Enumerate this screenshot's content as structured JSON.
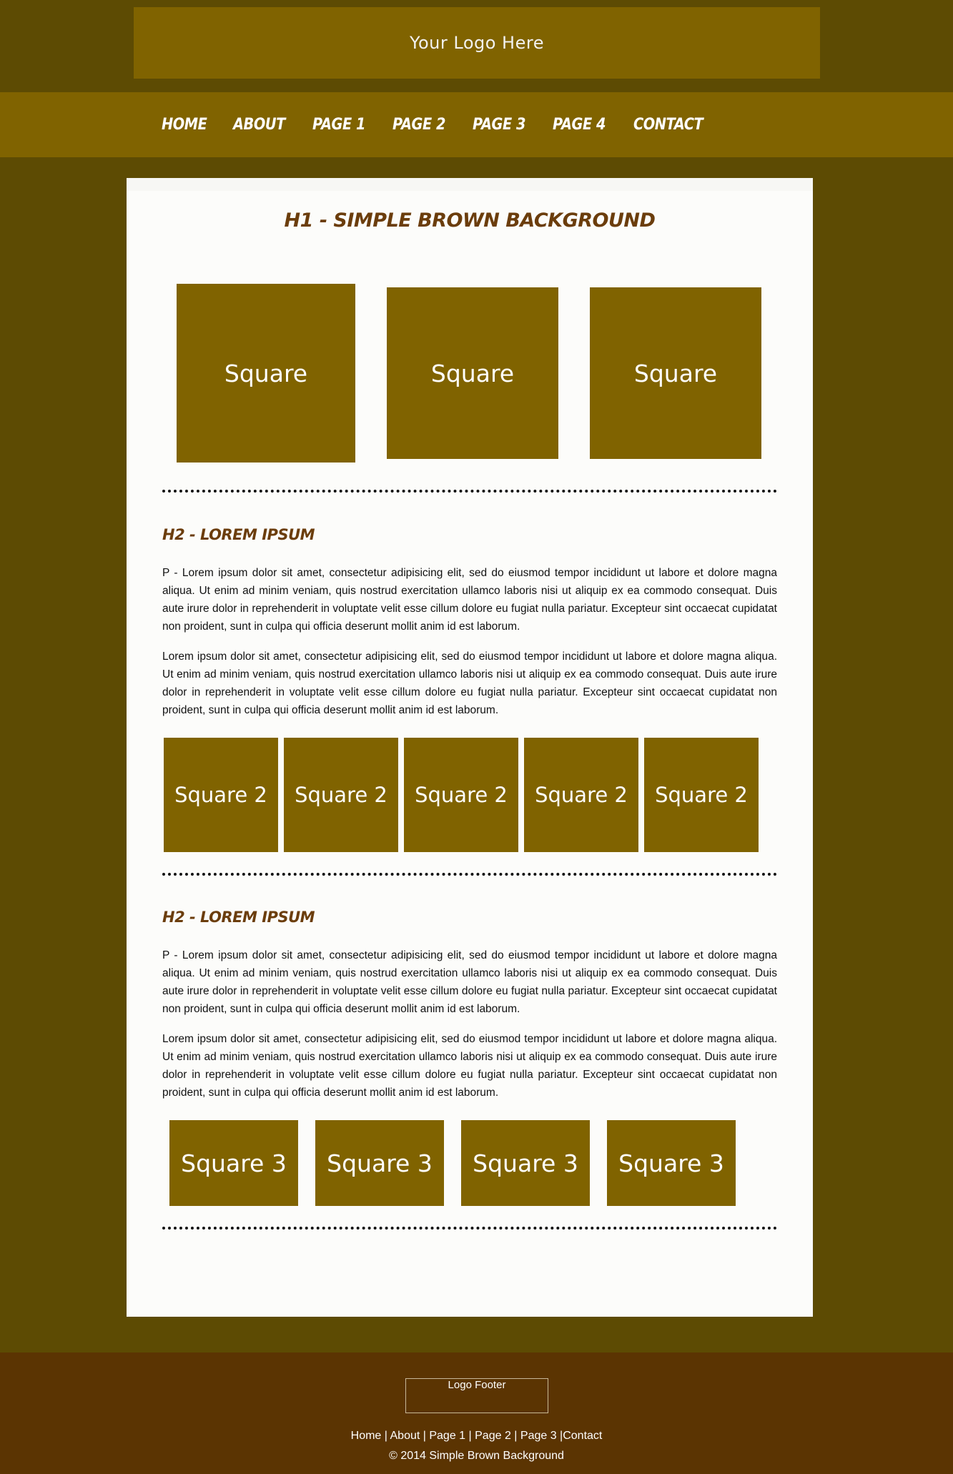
{
  "header": {
    "logo_text": "Your Logo Here"
  },
  "nav": {
    "items": [
      {
        "label": "Home"
      },
      {
        "label": "About"
      },
      {
        "label": "Page 1"
      },
      {
        "label": "Page 2"
      },
      {
        "label": "Page 3"
      },
      {
        "label": "Page 4"
      },
      {
        "label": "Contact"
      }
    ]
  },
  "main": {
    "h1": "H1 - Simple Brown Background",
    "squares_row1": [
      "Square",
      "Square",
      "Square"
    ],
    "section1": {
      "h2": "H2 - Lorem Ipsum",
      "p1": "P - Lorem ipsum dolor sit amet, consectetur adipisicing elit, sed do eiusmod tempor incididunt ut labore et dolore magna aliqua. Ut enim ad minim veniam, quis nostrud exercitation ullamco laboris nisi ut aliquip ex ea commodo consequat. Duis aute irure dolor in reprehenderit in voluptate velit esse cillum dolore eu fugiat nulla pariatur. Excepteur sint occaecat cupidatat non proident, sunt in culpa qui officia deserunt mollit anim id est laborum.",
      "p2": "Lorem ipsum dolor sit amet, consectetur adipisicing elit, sed do eiusmod tempor incididunt ut labore et dolore magna aliqua. Ut enim ad minim veniam, quis nostrud exercitation ullamco laboris nisi ut aliquip ex ea commodo consequat. Duis aute irure dolor in reprehenderit in voluptate velit esse cillum dolore eu fugiat nulla pariatur. Excepteur sint occaecat cupidatat non proident, sunt in culpa qui officia deserunt mollit anim id est laborum.",
      "squares": [
        "Square 2",
        "Square 2",
        "Square 2",
        "Square 2",
        "Square 2"
      ]
    },
    "section2": {
      "h2": "H2 - Lorem Ipsum",
      "p1": "P - Lorem ipsum dolor sit amet, consectetur adipisicing elit, sed do eiusmod tempor incididunt ut labore et dolore magna aliqua. Ut enim ad minim veniam, quis nostrud exercitation ullamco laboris nisi ut aliquip ex ea commodo consequat. Duis aute irure dolor in reprehenderit in voluptate velit esse cillum dolore eu fugiat nulla pariatur. Excepteur sint occaecat cupidatat non proident, sunt in culpa qui officia deserunt mollit anim id est laborum.",
      "p2": "Lorem ipsum dolor sit amet, consectetur adipisicing elit, sed do eiusmod tempor incididunt ut labore et dolore magna aliqua. Ut enim ad minim veniam, quis nostrud exercitation ullamco laboris nisi ut aliquip ex ea commodo consequat. Duis aute irure dolor in reprehenderit in voluptate velit esse cillum dolore eu fugiat nulla pariatur. Excepteur sint occaecat cupidatat non proident, sunt in culpa qui officia deserunt mollit anim id est laborum.",
      "squares": [
        "Square 3",
        "Square 3",
        "Square 3",
        "Square 3"
      ]
    }
  },
  "footer": {
    "logo_text": "Logo Footer",
    "links": [
      {
        "label": "Home"
      },
      {
        "label": "About"
      },
      {
        "label": "Page 1"
      },
      {
        "label": "Page 2"
      },
      {
        "label": "Page 3"
      },
      {
        "label": "Contact"
      }
    ],
    "sep": " | ",
    "sep_last": " |",
    "copyright": "© 2014 Simple Brown Background"
  },
  "colors": {
    "page_bg": "#5d4b03",
    "accent": "#806300",
    "heading": "#6b3d0c",
    "footer_bg": "#5b3402"
  }
}
